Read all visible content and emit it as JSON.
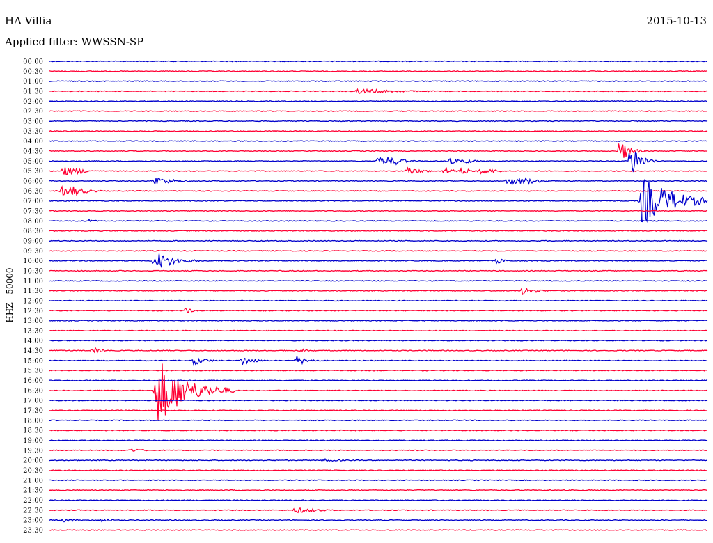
{
  "header": {
    "station": "HA Villia",
    "date": "2015-10-13",
    "filter": "Applied filter: WWSSN-SP"
  },
  "chart_data": {
    "type": "line",
    "title": "HA Villia",
    "subtitle": "Applied filter: WWSSN-SP",
    "ylabel": "HHZ - 50000",
    "xlabel": "",
    "trace_colors": [
      "#0000cc",
      "#ff0033"
    ],
    "row_times": [
      "00:00",
      "00:30",
      "01:00",
      "01:30",
      "02:00",
      "02:30",
      "03:00",
      "03:30",
      "04:00",
      "04:30",
      "05:00",
      "05:30",
      "06:00",
      "06:30",
      "07:00",
      "07:30",
      "08:00",
      "08:30",
      "09:00",
      "09:30",
      "10:00",
      "10:30",
      "11:00",
      "11:30",
      "12:00",
      "12:30",
      "13:00",
      "13:30",
      "14:00",
      "14:30",
      "15:00",
      "15:30",
      "16:00",
      "16:30",
      "17:00",
      "17:30",
      "18:00",
      "18:30",
      "19:00",
      "19:30",
      "20:00",
      "20:30",
      "21:00",
      "21:30",
      "22:00",
      "22:30",
      "23:00",
      "23:30"
    ],
    "row_span_minutes": 30,
    "events": [
      {
        "row": 3,
        "minute": 14.0,
        "amp": 0.25,
        "dur": 2.0
      },
      {
        "row": 9,
        "minute": 26.0,
        "amp": 1.2,
        "dur": 0.4
      },
      {
        "row": 10,
        "minute": 15.0,
        "amp": 0.4,
        "dur": 0.6
      },
      {
        "row": 10,
        "minute": 15.4,
        "amp": 0.45,
        "dur": 0.5
      },
      {
        "row": 10,
        "minute": 15.8,
        "amp": 0.4,
        "dur": 0.5
      },
      {
        "row": 10,
        "minute": 18.2,
        "amp": 0.35,
        "dur": 0.4
      },
      {
        "row": 10,
        "minute": 18.8,
        "amp": 0.4,
        "dur": 0.4
      },
      {
        "row": 10,
        "minute": 26.5,
        "amp": 2.0,
        "dur": 0.4
      },
      {
        "row": 11,
        "minute": 0.6,
        "amp": 0.55,
        "dur": 0.6
      },
      {
        "row": 11,
        "minute": 1.2,
        "amp": 0.4,
        "dur": 0.5
      },
      {
        "row": 11,
        "minute": 16.3,
        "amp": 0.45,
        "dur": 0.6
      },
      {
        "row": 11,
        "minute": 18.0,
        "amp": 0.35,
        "dur": 0.5
      },
      {
        "row": 11,
        "minute": 18.8,
        "amp": 0.35,
        "dur": 0.5
      },
      {
        "row": 11,
        "minute": 19.7,
        "amp": 0.35,
        "dur": 0.7
      },
      {
        "row": 12,
        "minute": 4.8,
        "amp": 0.5,
        "dur": 0.7
      },
      {
        "row": 12,
        "minute": 20.9,
        "amp": 0.45,
        "dur": 0.6
      },
      {
        "row": 12,
        "minute": 21.5,
        "amp": 0.45,
        "dur": 0.7
      },
      {
        "row": 13,
        "minute": 0.6,
        "amp": 0.55,
        "dur": 0.6
      },
      {
        "row": 13,
        "minute": 1.0,
        "amp": 0.6,
        "dur": 0.6
      },
      {
        "row": 14,
        "minute": 27.0,
        "amp": 2.5,
        "dur": 1.4
      },
      {
        "row": 16,
        "minute": 1.7,
        "amp": 0.25,
        "dur": 0.3
      },
      {
        "row": 20,
        "minute": 4.8,
        "amp": 1.0,
        "dur": 0.8
      },
      {
        "row": 20,
        "minute": 20.4,
        "amp": 0.35,
        "dur": 0.3
      },
      {
        "row": 23,
        "minute": 21.6,
        "amp": 0.5,
        "dur": 0.5
      },
      {
        "row": 25,
        "minute": 6.2,
        "amp": 0.35,
        "dur": 0.3
      },
      {
        "row": 29,
        "minute": 2.0,
        "amp": 0.35,
        "dur": 0.4
      },
      {
        "row": 29,
        "minute": 11.5,
        "amp": 0.15,
        "dur": 0.5
      },
      {
        "row": 30,
        "minute": 6.6,
        "amp": 0.5,
        "dur": 0.5
      },
      {
        "row": 30,
        "minute": 8.8,
        "amp": 0.5,
        "dur": 0.5
      },
      {
        "row": 30,
        "minute": 11.3,
        "amp": 0.5,
        "dur": 0.5
      },
      {
        "row": 33,
        "minute": 4.9,
        "amp": 3.5,
        "dur": 1.2
      },
      {
        "row": 39,
        "minute": 3.7,
        "amp": 0.2,
        "dur": 0.6
      },
      {
        "row": 40,
        "minute": 12.5,
        "amp": 0.15,
        "dur": 1.0
      },
      {
        "row": 45,
        "minute": 11.2,
        "amp": 0.3,
        "dur": 1.0
      },
      {
        "row": 46,
        "minute": 0.6,
        "amp": 0.25,
        "dur": 0.5
      },
      {
        "row": 46,
        "minute": 2.4,
        "amp": 0.2,
        "dur": 0.5
      }
    ]
  }
}
